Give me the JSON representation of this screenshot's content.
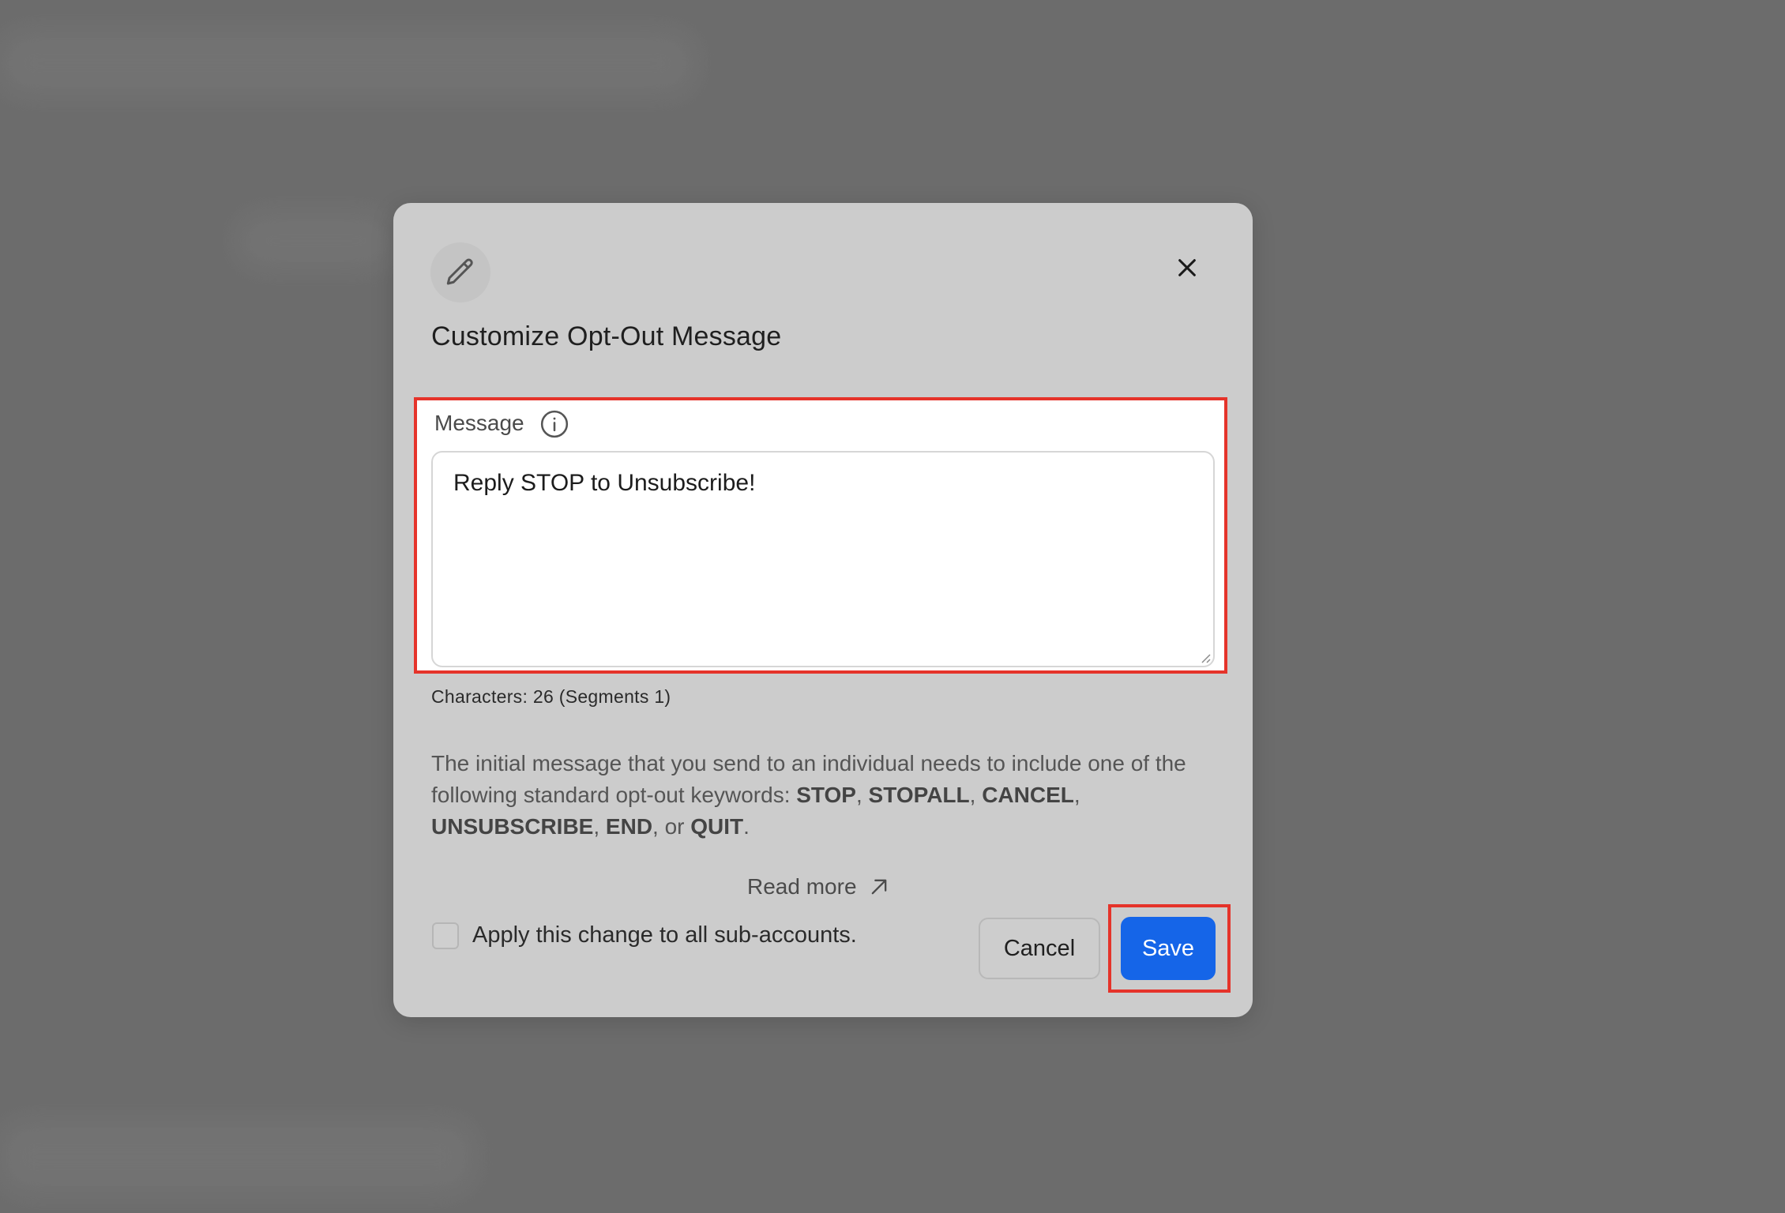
{
  "modal": {
    "title": "Customize Opt-Out Message",
    "field_label": "Message",
    "message_value": "Reply STOP to Unsubscribe!",
    "char_count": "Characters: 26 (Segments 1)",
    "help": {
      "intro": "The initial message that you send to an individual needs to include one of the following standard opt-out keywords: ",
      "keywords": [
        "STOP",
        "STOPALL",
        "CANCEL",
        "UNSUBSCRIBE",
        "END",
        "QUIT"
      ],
      "sep": ", ",
      "or": ", or ",
      "end": "."
    },
    "read_more": "Read more",
    "checkbox_label": "Apply this change to all sub-accounts.",
    "checkbox_checked": false,
    "cancel_label": "Cancel",
    "save_label": "Save"
  },
  "icons": {
    "edit": "pencil-icon",
    "close": "close-icon",
    "info": "info-icon",
    "external": "arrow-up-right-icon"
  },
  "colors": {
    "primary": "#1565e8",
    "highlight": "#e5332a",
    "modal_bg": "#cccccc"
  }
}
